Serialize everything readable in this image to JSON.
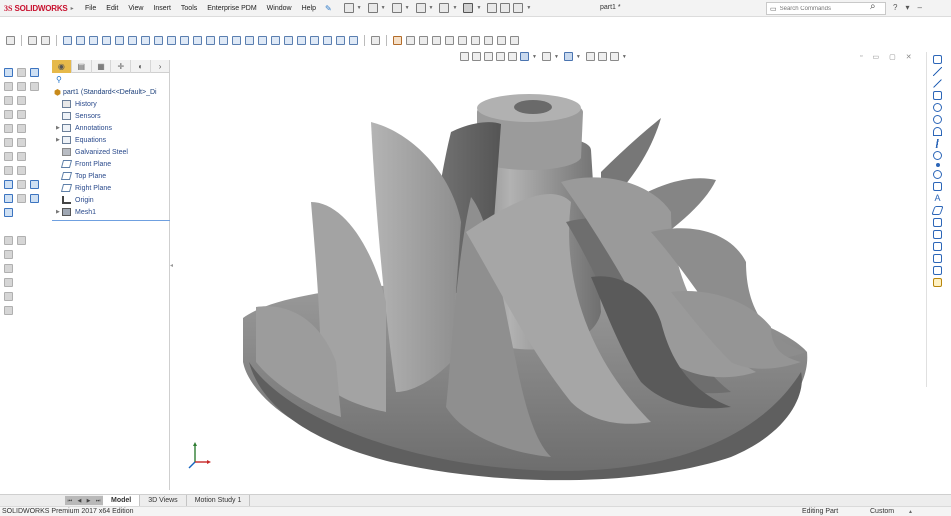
{
  "app": {
    "logo_ds": "3S",
    "logo_text": "SOLIDWORKS",
    "document_title": "part1 *"
  },
  "menu": [
    "File",
    "Edit",
    "View",
    "Insert",
    "Tools",
    "Enterprise PDM",
    "Window",
    "Help"
  ],
  "search": {
    "placeholder": "Search Commands"
  },
  "feature_tree": {
    "root": "part1  (Standard<<Default>_Di",
    "items": [
      {
        "label": "History",
        "icon": "history-icon",
        "expandable": false
      },
      {
        "label": "Sensors",
        "icon": "sensors-icon",
        "expandable": false
      },
      {
        "label": "Annotations",
        "icon": "annotations-icon",
        "expandable": true
      },
      {
        "label": "Equations",
        "icon": "equations-icon",
        "expandable": true
      },
      {
        "label": "Galvanized Steel",
        "icon": "material-icon",
        "expandable": false
      },
      {
        "label": "Front Plane",
        "icon": "plane-icon",
        "expandable": false
      },
      {
        "label": "Top Plane",
        "icon": "plane-icon",
        "expandable": false
      },
      {
        "label": "Right Plane",
        "icon": "plane-icon",
        "expandable": false
      },
      {
        "label": "Origin",
        "icon": "origin-icon",
        "expandable": false
      },
      {
        "label": "Mesh1",
        "icon": "mesh-icon",
        "expandable": true
      }
    ]
  },
  "bottom_tabs": [
    {
      "label": "Model",
      "active": true
    },
    {
      "label": "3D Views",
      "active": false
    },
    {
      "label": "Motion Study 1",
      "active": false
    }
  ],
  "status": {
    "product": "SOLIDWORKS Premium 2017 x64 Edition",
    "mode": "Editing Part",
    "units": "Custom"
  },
  "colors": {
    "brand": "#c8102e",
    "accent": "#2c66b8",
    "model_gray": "#8a8a8a"
  }
}
